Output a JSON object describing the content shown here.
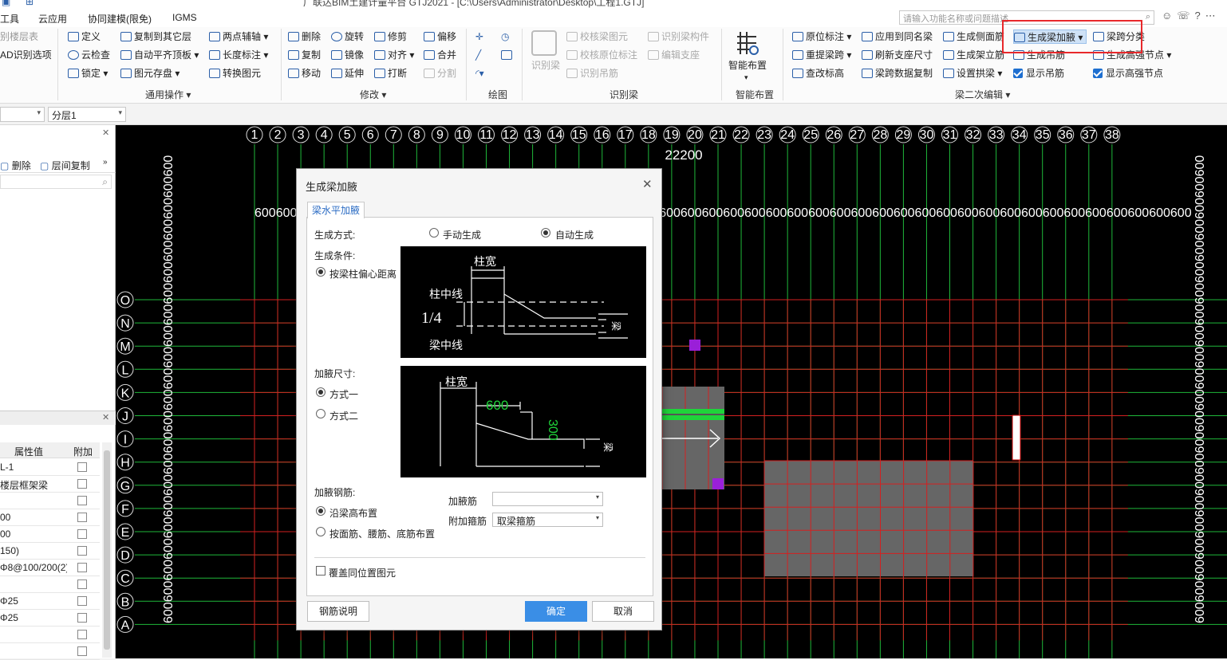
{
  "titlebar": {
    "text": "广联达BIM土建计量平台 GTJ2021 - [C:\\Users\\Administrator\\Desktop\\工程1.GTJ]"
  },
  "menu": {
    "items": [
      "工具",
      "云应用",
      "协同建模(限免)",
      "IGMS"
    ]
  },
  "search": {
    "placeholder": "请输入功能名称或问题描述"
  },
  "ribbon": {
    "col0": [
      "别楼层表",
      "AD识别选项"
    ],
    "general": [
      "定义",
      "云检查",
      "锁定",
      "复制到其它层",
      "自动平齐顶板",
      "图元存盘",
      "两点辅轴",
      "长度标注",
      "转换图元"
    ],
    "modify": [
      "删除",
      "复制",
      "移动",
      "旋转",
      "镜像",
      "延伸",
      "修剪",
      "对齐",
      "打断",
      "偏移",
      "合并",
      "分割"
    ],
    "recog_beam": [
      "识别梁",
      "校核梁图元",
      "校核原位标注",
      "识别吊筋",
      "识别梁构件",
      "编辑支座"
    ],
    "smart_layout": "智能布置",
    "beam_edit": [
      "原位标注",
      "重提梁跨",
      "查改标高",
      "应用到同名梁",
      "刷新支座尺寸",
      "梁跨数据复制",
      "生成侧面筋",
      "生成架立筋",
      "设置拱梁",
      "生成梁加腋",
      "生成吊筋",
      "显示吊筋",
      "梁跨分类",
      "生成高强节点",
      "显示高强节点"
    ],
    "groups": {
      "general": "通用操作",
      "modify": "修改",
      "draw": "绘图",
      "recog": "识别梁",
      "smart": "智能布置",
      "beam2": "梁二次编辑"
    }
  },
  "toolbar2": {
    "layer": "分层1"
  },
  "leftpanel": {
    "actions": [
      "删除",
      "层间复制"
    ],
    "headers": [
      "属性值",
      "附加"
    ],
    "rows": [
      "L-1",
      "楼层框架梁",
      "",
      "00",
      "00",
      "150)",
      "Φ8@100/200(2)",
      "",
      "Φ25",
      "Φ25",
      "",
      ""
    ]
  },
  "canvas": {
    "top_axis": [
      "1",
      "2",
      "3",
      "4",
      "5",
      "6",
      "7",
      "8",
      "9",
      "10",
      "11",
      "12",
      "13",
      "14",
      "15",
      "16",
      "17",
      "18",
      "19",
      "20",
      "21",
      "22",
      "23",
      "24",
      "25",
      "26",
      "27",
      "28",
      "29",
      "30",
      "31",
      "32",
      "33",
      "34",
      "35",
      "36",
      "37",
      "38"
    ],
    "total_dim": "22200",
    "top_dims": "600600600600600600600600600600600600600600600600600600600600600600600600600600600600600600600600600600600600600600600600600600600600",
    "left_axis": [
      "O",
      "N",
      "M",
      "L",
      "K",
      "J",
      "I",
      "H",
      "G",
      "F",
      "E",
      "D",
      "C",
      "B",
      "A"
    ],
    "side_dims": "600600600600600600600600600600600600600600600600600600600600600600",
    "colors": {
      "grid_green": "#1fb83a",
      "grid_red": "#d42020",
      "axis_text": "#ffffff"
    }
  },
  "dialog": {
    "title": "生成梁加腋",
    "tab": "梁水平加腋",
    "method_label": "生成方式:",
    "manual": "手动生成",
    "auto": "自动生成",
    "condition_label": "生成条件:",
    "condition_opt": "按梁柱偏心距离",
    "img1": {
      "col_width": "柱宽",
      "col_center": "柱中线",
      "ratio": "1/4",
      "beam_center": "梁中线",
      "beam_text": "梁"
    },
    "size_label": "加腋尺寸:",
    "size_opt1": "方式一",
    "size_opt2": "方式二",
    "img2": {
      "col_width": "柱宽",
      "dim1": "600",
      "dim2": "300",
      "beam_text": "梁"
    },
    "rebar_label": "加腋钢筋:",
    "rebar_opt1": "沿梁高布置",
    "rebar_opt2": "按面筋、腰筋、底筋布置",
    "haunch_rebar_label": "加腋筋",
    "haunch_rebar_value": "",
    "extra_stirrup_label": "附加箍筋",
    "extra_stirrup_value": "取梁箍筋",
    "override": "覆盖同位置图元",
    "btn_desc": "钢筋说明",
    "btn_ok": "确定",
    "btn_cancel": "取消"
  }
}
